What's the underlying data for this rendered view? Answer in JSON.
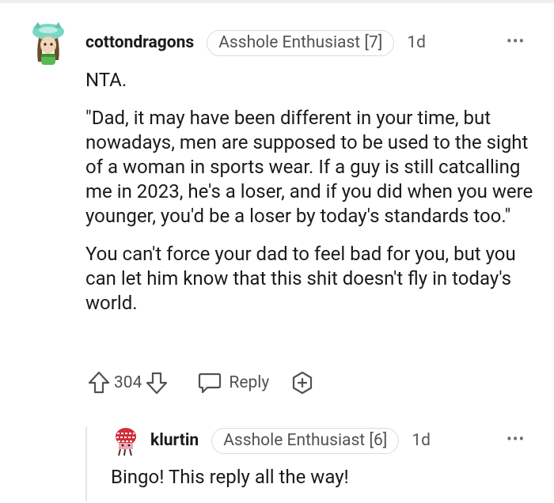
{
  "comment": {
    "username": "cottondragons",
    "flair": "Asshole Enthusiast [7]",
    "age": "1d",
    "paragraphs": [
      "NTA.",
      "\"Dad, it may have been different in your time, but nowadays, men are supposed to be used to the sight of a woman in sports wear. If a guy is still catcalling me in 2023, he's a loser, and if you did when you were younger, you'd be a loser by today's standards too.\"",
      "You can't force your dad to feel bad for you, but you can let him know that this shit doesn't fly in today's world."
    ],
    "votes": "304",
    "reply_label": "Reply",
    "more_label": "•••"
  },
  "reply": {
    "username": "klurtin",
    "flair": "Asshole Enthusiast [6]",
    "age": "1d",
    "text": "Bingo! This reply all the way!",
    "more_label": "•••"
  },
  "colors": {
    "text": "#1a1a1b",
    "meta": "#4f5356",
    "border": "#d9dbdd"
  },
  "icons": [
    "cottondragons-avatar",
    "upvote-icon",
    "downvote-icon",
    "reply-icon",
    "award-icon",
    "klurtin-avatar",
    "more-options-icon"
  ]
}
